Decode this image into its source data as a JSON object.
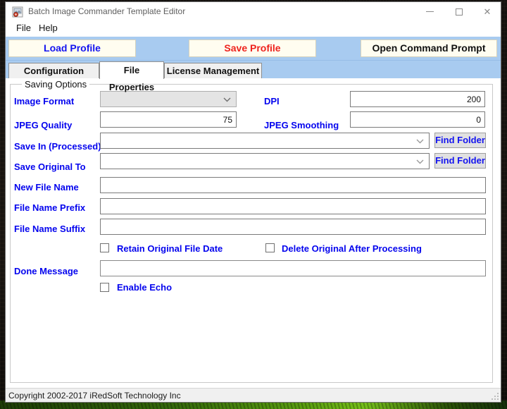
{
  "window": {
    "title": "Batch Image Commander Template Editor",
    "controls": {
      "minimize": "minimize",
      "maximize": "maximize",
      "close": "✕"
    }
  },
  "menu": {
    "items": [
      {
        "label": "File"
      },
      {
        "label": "Help"
      }
    ]
  },
  "toolbar": {
    "load_label": "Load Profile",
    "save_label": "Save Profile",
    "open_label": "Open Command Prompt"
  },
  "tabs": [
    {
      "label": "Configuration Module",
      "active": false
    },
    {
      "label": "File Properties",
      "active": true
    },
    {
      "label": "License Management",
      "active": false
    }
  ],
  "group": {
    "legend": "Saving Options"
  },
  "fields": {
    "image_format": {
      "label": "Image Format",
      "value": "",
      "disabled": true
    },
    "dpi": {
      "label": "DPI",
      "value": "200"
    },
    "jpeg_quality": {
      "label": "JPEG Quality",
      "value": "75"
    },
    "jpeg_smoothing": {
      "label": "JPEG Smoothing",
      "value": "0"
    },
    "save_in": {
      "label": "Save In (Processed)",
      "value": "",
      "button": "Find Folder"
    },
    "save_original": {
      "label": "Save Original To",
      "value": "",
      "button": "Find Folder"
    },
    "new_file_name": {
      "label": "New File Name",
      "value": ""
    },
    "file_name_prefix": {
      "label": "File Name Prefix",
      "value": ""
    },
    "file_name_suffix": {
      "label": "File Name Suffix",
      "value": ""
    },
    "retain_date": {
      "label": "Retain Original File Date",
      "checked": false
    },
    "delete_original": {
      "label": "Delete Original After Processing",
      "checked": false
    },
    "done_message": {
      "label": "Done Message",
      "value": ""
    },
    "enable_echo": {
      "label": "Enable Echo",
      "checked": false
    }
  },
  "statusbar": {
    "text": "Copyright 2002-2017 iRedSoft Technology Inc"
  },
  "colors": {
    "band_blue": "#a8cbf0",
    "label_blue": "#0404ee",
    "save_red": "#ee231d",
    "button_ivory": "#fffdf0",
    "inactive_tab": "#f0f0f0",
    "statusbar_gray": "#f0f0f0"
  }
}
